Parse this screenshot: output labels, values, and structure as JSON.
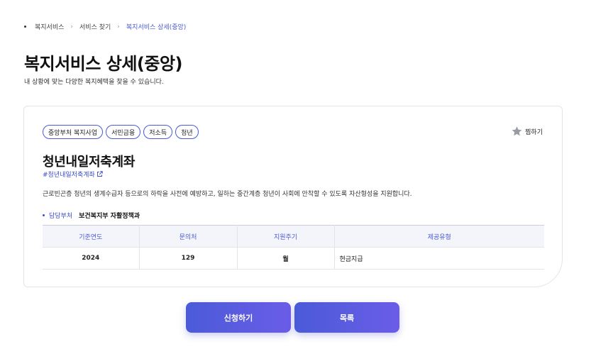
{
  "breadcrumb": {
    "items": [
      "복지서비스",
      "서비스 찾기",
      "복지서비스 상세(중앙)"
    ]
  },
  "page": {
    "title": "복지서비스 상세(중앙)",
    "subtitle": "내 상황에 맞는 다양한 복지혜택을 찾을 수 있습니다."
  },
  "card": {
    "tags": [
      "중앙부처 복지사업",
      "서민금융",
      "저소득",
      "청년"
    ],
    "bookmark_label": "찜하기",
    "title": "청년내일저축계좌",
    "hashtag": "#청년내일저축계좌",
    "description": "근로빈곤층 청년의 생계수급자 등으로의 하락을 사전에 예방하고, 일하는 중간계층 청년이 사회에 안착할 수 있도록 자산형성을 지원합니다.",
    "dept_label": "담당부처",
    "dept_value": "보건복지부 자활정책과",
    "table": {
      "headers": [
        "기준연도",
        "문의처",
        "지원주기",
        "제공유형"
      ],
      "row": [
        "2024",
        "129",
        "월",
        "현금지급"
      ]
    }
  },
  "buttons": {
    "apply": "신청하기",
    "list": "목록"
  },
  "colors": {
    "accent": "#4b5ad6",
    "button_gradient_start": "#4a5bd8",
    "button_gradient_end": "#6b5ce8",
    "table_header_bg": "#f3f5fa"
  },
  "icons": {
    "bookmark": "star-icon",
    "external_link": "external-link-icon",
    "breadcrumb_separator": "chevron-right-icon"
  }
}
